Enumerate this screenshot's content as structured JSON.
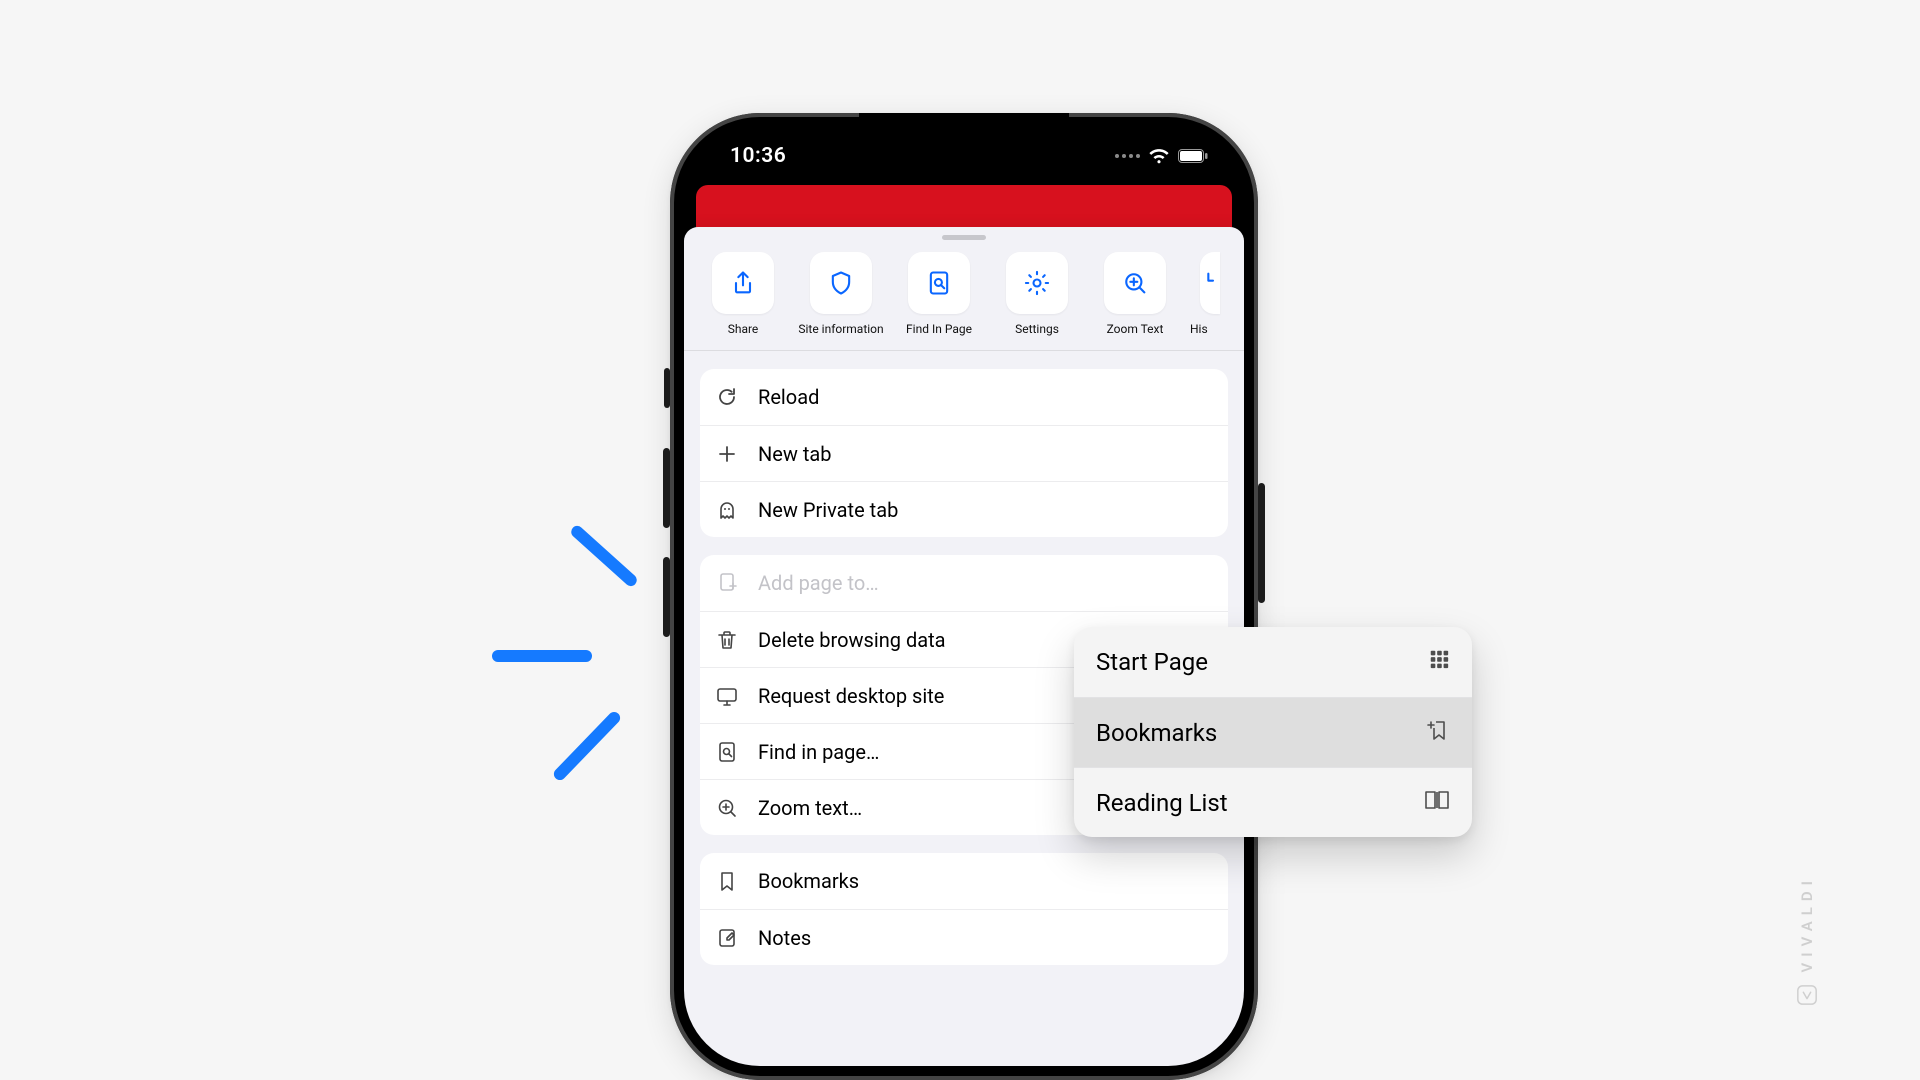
{
  "statusbar": {
    "time": "10:36"
  },
  "tiles": [
    {
      "id": "share",
      "label": "Share",
      "icon": "share-icon"
    },
    {
      "id": "siteinfo",
      "label": "Site information",
      "icon": "shield-icon"
    },
    {
      "id": "findpage",
      "label": "Find In Page",
      "icon": "find-in-page-icon"
    },
    {
      "id": "settings",
      "label": "Settings",
      "icon": "gear-icon"
    },
    {
      "id": "zoom",
      "label": "Zoom Text",
      "icon": "zoom-in-icon"
    },
    {
      "id": "history",
      "label": "His",
      "icon": "history-icon"
    }
  ],
  "group1": {
    "reload": "Reload",
    "newtab": "New tab",
    "private": "New Private tab"
  },
  "group2": {
    "addpage": "Add page to…",
    "delete": "Delete browsing data",
    "desktop": "Request desktop site",
    "find": "Find in page…",
    "zoom": "Zoom text…"
  },
  "group3": {
    "bookmarks": "Bookmarks",
    "notes": "Notes"
  },
  "popover": {
    "start": "Start Page",
    "bookmarks": "Bookmarks",
    "reading": "Reading List"
  },
  "watermark": "VIVALDI"
}
